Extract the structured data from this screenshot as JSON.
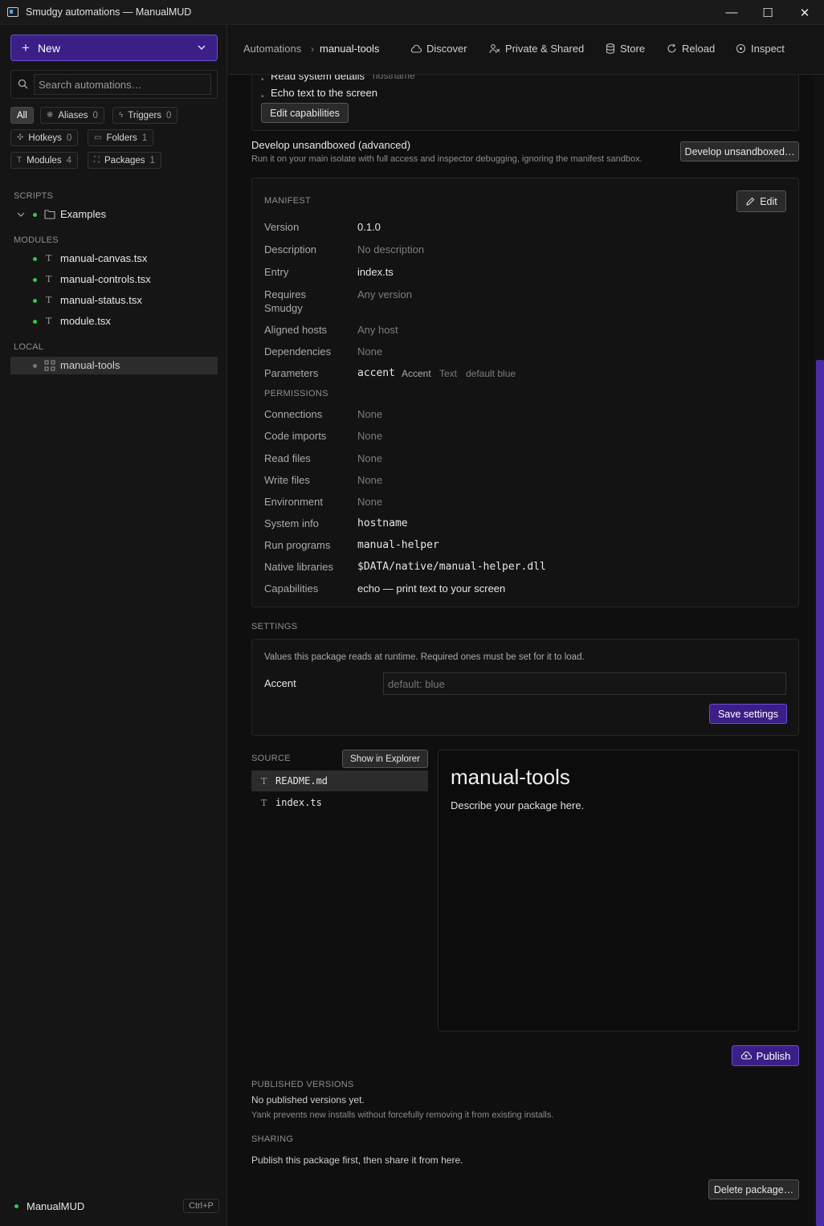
{
  "window": {
    "title": "Smudgy automations — ManualMUD",
    "controls": {
      "minimize": "—",
      "maximize": "☐",
      "close": "✕"
    }
  },
  "sidebar": {
    "new_label": "New",
    "search_placeholder": "Search automations…",
    "filters": [
      {
        "label": "All",
        "count": ""
      },
      {
        "label": "Aliases",
        "count": "0"
      },
      {
        "label": "Triggers",
        "count": "0"
      },
      {
        "label": "Hotkeys",
        "count": "0"
      },
      {
        "label": "Folders",
        "count": "1"
      },
      {
        "label": "Modules",
        "count": "4"
      },
      {
        "label": "Packages",
        "count": "1"
      }
    ],
    "scripts_label": "SCRIPTS",
    "scripts": [
      {
        "label": "Examples"
      }
    ],
    "modules_label": "MODULES",
    "modules": [
      {
        "label": "manual-canvas.tsx"
      },
      {
        "label": "manual-controls.tsx"
      },
      {
        "label": "manual-status.tsx"
      },
      {
        "label": "module.tsx"
      }
    ],
    "local_label": "LOCAL",
    "local": [
      {
        "label": "manual-tools"
      }
    ],
    "status": {
      "profile": "ManualMUD",
      "shortcut": "Ctrl+P"
    }
  },
  "header": {
    "breadcrumb": [
      "Automations",
      "manual-tools"
    ],
    "separator": "›",
    "nav": [
      {
        "label": "Discover",
        "icon": "cloud-icon"
      },
      {
        "label": "Private & Shared",
        "icon": "users-icon"
      },
      {
        "label": "Store",
        "icon": "database-icon"
      },
      {
        "label": "Reload",
        "icon": "refresh-icon"
      },
      {
        "label": "Inspect",
        "icon": "target-icon"
      }
    ]
  },
  "capabilities": {
    "cut_item": {
      "label": "Read system details",
      "hint": "hostname"
    },
    "item": "Echo text to the screen",
    "edit_button": "Edit capabilities"
  },
  "develop": {
    "title": "Develop unsandboxed (advanced)",
    "description": "Run it on your main isolate with full access and inspector debugging, ignoring the manifest sandbox.",
    "button": "Develop unsandboxed…"
  },
  "manifest": {
    "heading": "MANIFEST",
    "edit_button": "Edit",
    "rows": {
      "version": {
        "label": "Version",
        "value": "0.1.0"
      },
      "description": {
        "label": "Description",
        "value": "No description"
      },
      "entry": {
        "label": "Entry",
        "value": "index.ts"
      },
      "requires": {
        "label1": "Requires",
        "label2": "Smudgy",
        "value": "Any version"
      },
      "hosts": {
        "label": "Aligned hosts",
        "value": "Any host"
      },
      "dependencies": {
        "label": "Dependencies",
        "value": "None"
      },
      "parameters": {
        "label": "Parameters",
        "name": "accent",
        "title": "Accent",
        "type": "Text",
        "default": "default blue"
      }
    },
    "permissions_heading": "PERMISSIONS",
    "permissions": {
      "connections": {
        "label": "Connections",
        "value": "None"
      },
      "imports": {
        "label": "Code imports",
        "value": "None"
      },
      "read": {
        "label": "Read files",
        "value": "None"
      },
      "write": {
        "label": "Write files",
        "value": "None"
      },
      "env": {
        "label": "Environment",
        "value": "None"
      },
      "sysinfo": {
        "label": "System info",
        "value": "hostname"
      },
      "run": {
        "label": "Run programs",
        "value": "manual-helper"
      },
      "native": {
        "label": "Native libraries",
        "value": "$DATA/native/manual-helper.dll"
      },
      "caps": {
        "label": "Capabilities",
        "value": "echo — print text to your screen"
      }
    }
  },
  "settings": {
    "heading": "SETTINGS",
    "description": "Values this package reads at runtime. Required ones must be set for it to load.",
    "field_label": "Accent",
    "field_placeholder": "default: blue",
    "save_button": "Save settings"
  },
  "source": {
    "heading": "SOURCE",
    "explorer_button": "Show in Explorer",
    "files": [
      {
        "label": "README.md"
      },
      {
        "label": "index.ts"
      }
    ],
    "preview_title": "manual-tools",
    "preview_body": "Describe your package here."
  },
  "publish_button": "Publish",
  "published": {
    "heading": "PUBLISHED VERSIONS",
    "empty": "No published versions yet.",
    "note": "Yank prevents new installs without forcefully removing it from existing installs."
  },
  "sharing": {
    "heading": "SHARING",
    "text": "Publish this package first, then share it from here."
  },
  "delete_button": "Delete package…"
}
